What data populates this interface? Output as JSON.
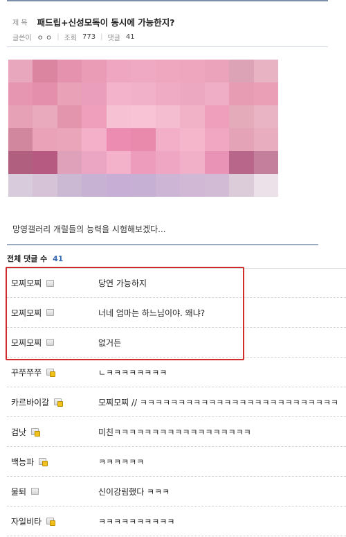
{
  "post": {
    "title_label": "제 목",
    "title": "패드립+신성모독이 동시에 가능한지?",
    "author_label": "글쓴이",
    "author": "ㅇ ㅇ",
    "views_label": "조회",
    "views": "773",
    "comments_label": "댓글",
    "comments": "41",
    "body_text": "망영갤러리 개럴들의 능력을 시험해보겠다..."
  },
  "mosaic": {
    "colors": [
      [
        "#e9a7bd",
        "#dc85a1",
        "#e492ae",
        "#ea9cb7",
        "#efa7c1",
        "#f0a9c3",
        "#efa7c0",
        "#eea6bf",
        "#eba3bc",
        "#dca3b6",
        "#e8b3c3"
      ],
      [
        "#e696b0",
        "#e48fab",
        "#e9a1b8",
        "#eb9ebb",
        "#f2b3cb",
        "#f1b1c8",
        "#efabc3",
        "#eda8c1",
        "#f0aec6",
        "#e89cb4",
        "#ea9fb6"
      ],
      [
        "#e6a1b6",
        "#e9aabd",
        "#e495ae",
        "#ef9fbc",
        "#f6c1d3",
        "#f7c3d5",
        "#f5bdd0",
        "#f1b2c8",
        "#ef9fbb",
        "#e4abbb",
        "#e9b5c4"
      ],
      [
        "#d1879d",
        "#e9a2b8",
        "#eaa5bb",
        "#f3b0c8",
        "#ec8cb0",
        "#e989ac",
        "#f3afc7",
        "#f5b6cc",
        "#f1a7c2",
        "#e5a3b7",
        "#e8adbf"
      ],
      [
        "#b05f7e",
        "#b65a82",
        "#dfa0b9",
        "#eaa6c2",
        "#f4b1ca",
        "#ee9cbc",
        "#efa6c2",
        "#f2b0c8",
        "#e994b6",
        "#b86689",
        "#c37f9c"
      ],
      [
        "#d8ccdc",
        "#d6c3d8",
        "#cbb9d4",
        "#c7b2d3",
        "#c6aed4",
        "#c6b0d3",
        "#cdb6d5",
        "#d1b9d5",
        "#d2bbd4",
        "#dccbd9",
        "#ece1e8"
      ]
    ]
  },
  "comment_section": {
    "label": "전체 댓글 수",
    "count": "41"
  },
  "comments": [
    {
      "nick": "모찌모찌",
      "text": "당연 가능하지",
      "badge": false
    },
    {
      "nick": "모찌모찌",
      "text": "너네 엄마는 하느님이야. 왜냐?",
      "badge": false
    },
    {
      "nick": "모찌모찌",
      "text": "없거든",
      "badge": false
    },
    {
      "nick": "꾸쭈쭈쭈",
      "text": "ㄴㅋㅋㅋㅋㅋㅋㅋㅋ",
      "badge": true
    },
    {
      "nick": "카르바이갈",
      "text": "모찌모찌 // ㅋㅋㅋㅋㅋㅋㅋㅋㅋㅋㅋㅋㅋㅋㅋㅋㅋㅋㅋㅋㅋㅋㅋㅋㅋㅋ",
      "badge": true
    },
    {
      "nick": "검낫",
      "text": "미친ㅋㅋㅋㅋㅋㅋㅋㅋㅋㅋㅋㅋㅋㅋㅋㅋㅋㅋ",
      "badge": true
    },
    {
      "nick": "백능파",
      "text": "ㅋㅋㅋㅋㅋㅋ",
      "badge": true
    },
    {
      "nick": "물퇴",
      "text": "신이강림했다 ㅋㅋㅋ",
      "badge": false
    },
    {
      "nick": "자일비타",
      "text": "ㅋㅋㅋㅋㅋㅋㅋㅋㅋㅋ",
      "badge": true
    }
  ],
  "colors": {
    "highlight_border": "#d02a2a",
    "count_accent": "#3a6ab5",
    "header_rule": "#7d8fa8"
  }
}
